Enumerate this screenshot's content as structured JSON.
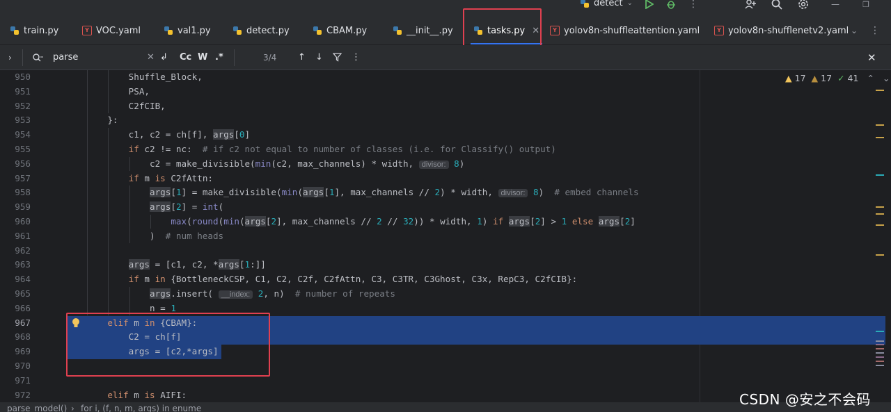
{
  "run_config": {
    "name": "detect"
  },
  "tabs": [
    {
      "label": "train.py",
      "type": "py"
    },
    {
      "label": "VOC.yaml",
      "type": "yaml"
    },
    {
      "label": "val1.py",
      "type": "py"
    },
    {
      "label": "detect.py",
      "type": "py"
    },
    {
      "label": "CBAM.py",
      "type": "py"
    },
    {
      "label": "__init__.py",
      "type": "py"
    },
    {
      "label": "tasks.py",
      "type": "py",
      "active": true
    },
    {
      "label": "yolov8n-shuffleattention.yaml",
      "type": "yaml"
    },
    {
      "label": "yolov8n-shufflenetv2.yaml",
      "type": "yaml"
    }
  ],
  "find": {
    "query": "parse",
    "match_case_label": "Cc",
    "words_label": "W",
    "regex_label": ".*",
    "result_count": "3/4"
  },
  "inspections": {
    "warnings": "17",
    "weak_warnings": "17",
    "ok": "41"
  },
  "line_numbers": [
    "950",
    "951",
    "952",
    "953",
    "954",
    "955",
    "956",
    "957",
    "958",
    "959",
    "960",
    "961",
    "962",
    "963",
    "964",
    "965",
    "966",
    "967",
    "968",
    "969",
    "970",
    "971",
    "972"
  ],
  "hints": {
    "divisor": "divisor:",
    "index": "__index:"
  },
  "statusbar": {
    "breadcrumb_1": "parse_model()",
    "breadcrumb_2": "for i, (f, n, m, args) in enume"
  },
  "watermark": "CSDN @安之不会码",
  "colors": {
    "accent": "#3574f0",
    "selection": "#214283",
    "annotation_box": "#e04050"
  }
}
